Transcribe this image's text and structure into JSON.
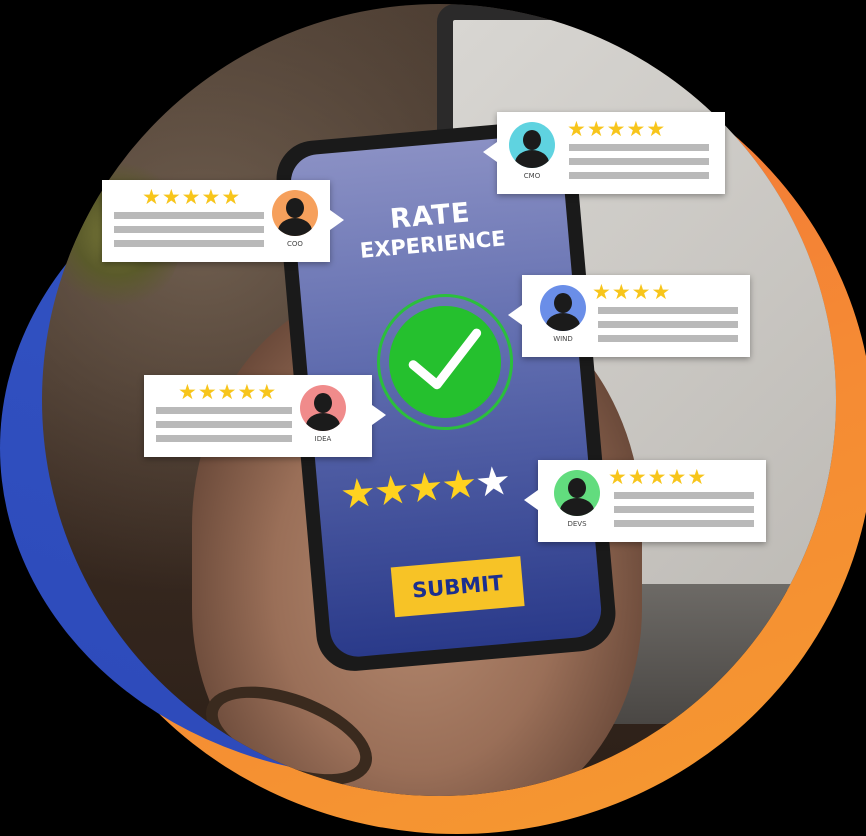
{
  "phone": {
    "title": "RATE",
    "subtitle": "EXPERIENCE",
    "rating": {
      "value": 4,
      "max": 5
    },
    "star_on": "★",
    "star_off": "★",
    "submit_label": "SUBMIT"
  },
  "colors": {
    "check_green": "#25c02e",
    "star_yellow": "#ffd21f",
    "submit_bg": "#f7c326",
    "ring_orange": "#f58a34",
    "ring_blue": "#2d49b9"
  },
  "reviews": [
    {
      "name": "COO",
      "stars": 5,
      "avatar_color": "#f6a05c",
      "icon": "user-avatar-icon"
    },
    {
      "name": "CMO",
      "stars": 5,
      "avatar_color": "#5fd3e0",
      "icon": "user-avatar-icon"
    },
    {
      "name": "WIND",
      "stars": 4,
      "avatar_color": "#6a8ee8",
      "icon": "user-avatar-icon"
    },
    {
      "name": "IDEA",
      "stars": 5,
      "avatar_color": "#f08b8b",
      "icon": "user-avatar-icon"
    },
    {
      "name": "DEVS",
      "stars": 5,
      "avatar_color": "#62dc7e",
      "icon": "user-avatar-icon"
    }
  ]
}
